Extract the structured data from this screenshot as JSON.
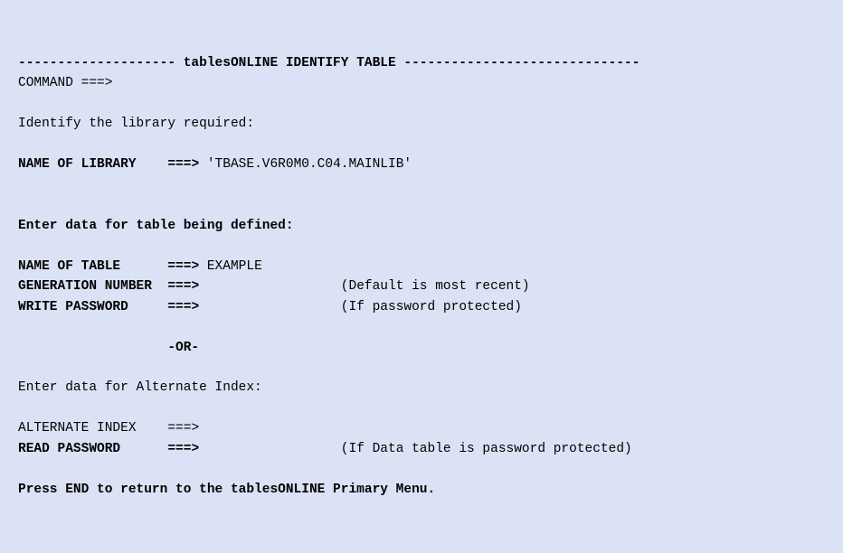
{
  "header": {
    "dashes_left": "--------------------",
    "title": "tablesONLINE IDENTIFY TABLE",
    "dashes_right": "------------------------------"
  },
  "command": {
    "label": "COMMAND",
    "arrow": "===>",
    "value": ""
  },
  "identify_library": {
    "prompt": "Identify the library required:",
    "label": "NAME OF LIBRARY",
    "arrow": "===>",
    "value": "'TBASE.V6R0M0.C04.MAINLIB'"
  },
  "define_table": {
    "prompt": "Enter data for table being defined:",
    "name_label": "NAME OF TABLE",
    "name_arrow": "===>",
    "name_value": "EXAMPLE",
    "gen_label": "GENERATION NUMBER",
    "gen_arrow": "===>",
    "gen_value": "",
    "gen_hint": "(Default is most recent)",
    "pwd_label": "WRITE PASSWORD",
    "pwd_arrow": "===>",
    "pwd_value": "",
    "pwd_hint": "(If password protected)"
  },
  "or_label": "-OR-",
  "alternate": {
    "prompt": "Enter data for Alternate Index:",
    "idx_label": "ALTERNATE INDEX",
    "idx_arrow": "===>",
    "idx_value": "",
    "read_label": "READ PASSWORD",
    "read_arrow": "===>",
    "read_value": "",
    "read_hint": "(If Data table is password protected)"
  },
  "footer": {
    "text": "Press END to return to the tablesONLINE Primary Menu."
  }
}
